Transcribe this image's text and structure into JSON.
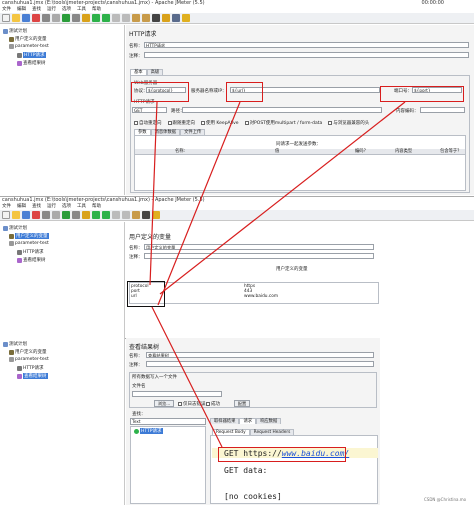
{
  "window1": {
    "title": "canshuhua1.jmx (E:\\tools\\jmeter-projects\\canshuhua1.jmx) - Apache JMeter (5.5)",
    "timer": "00:00:00",
    "menus": [
      "文件",
      "编辑",
      "查找",
      "运行",
      "选项",
      "工具",
      "帮助"
    ],
    "tree": {
      "plan": "测试计划",
      "var": "用户定义的变量",
      "group": "parameter-test",
      "http": "HTTP请求",
      "result": "查看结果树"
    },
    "panel_title": "HTTP请求",
    "name_label": "名称：",
    "name_value": "HTTP请求",
    "comment_label": "注释：",
    "tabs": [
      "基本",
      "高级"
    ],
    "web_server": "Web服务器",
    "protocol_label": "协议：",
    "protocol_value": "${protocol}",
    "server_label": "服务器名称或IP：",
    "server_value": "${url}",
    "port_label": "端口号：",
    "port_value": "${port}",
    "http_request": "HTTP请求",
    "method": "GET",
    "path_label": "路径：",
    "encoding_label": "内容编码：",
    "opts": [
      "自动重定向",
      "跟随重定向",
      "使用 KeepAlive",
      "对POST使用multipart / form-data",
      "与浏览器兼容的头"
    ],
    "sub_tabs": [
      "参数",
      "消息体数据",
      "文件上传"
    ],
    "params_header": "同请求一起发送参数：",
    "param_cols": [
      "名称:",
      "值",
      "编码？",
      "内容类型",
      "包含等于？"
    ]
  },
  "window2": {
    "title": "canshuhua1.jmx (E:\\tools\\jmeter-projects\\canshuhua1.jmx) - Apache JMeter (5.5)",
    "menus": [
      "文件",
      "编辑",
      "查找",
      "运行",
      "选项",
      "工具",
      "帮助"
    ],
    "panel_title": "用户定义的变量",
    "name_label": "名称：",
    "name_value": "用户定义的变量",
    "comment_label": "注释：",
    "table_title": "用户定义的变量",
    "rows": [
      {
        "name": "protocol",
        "value": "https"
      },
      {
        "name": "port",
        "value": "443"
      },
      {
        "name": "url",
        "value": "www.baidu.com"
      }
    ]
  },
  "window3": {
    "panel_title": "查看结果树",
    "name_label": "名称：",
    "name_value": "查看结果树",
    "comment_label": "注释：",
    "all_data": "所有数据写入一个文件",
    "file_label": "文件名",
    "browse": "浏览...",
    "log_only": "仅日志错误",
    "success": "成功",
    "configure": "配置",
    "search_label": "查找：",
    "renderer": "Text",
    "result_item": "HTTP请求",
    "tabs": [
      "取样器结果",
      "请求",
      "响应数据"
    ],
    "req_tabs": [
      "Request Body",
      "Request Headers"
    ],
    "body_lines": [
      "GET https://www.baidu.com/",
      "GET data:",
      "",
      "[no cookies]"
    ],
    "url_plain": "GET https://",
    "url_link": "www.baidu.com/"
  },
  "watermark": "CSDN @Christina.mo",
  "colors": {
    "accent_red": "#d81e1e",
    "selection": "#3d7bd6",
    "link": "#1a4fd8"
  }
}
